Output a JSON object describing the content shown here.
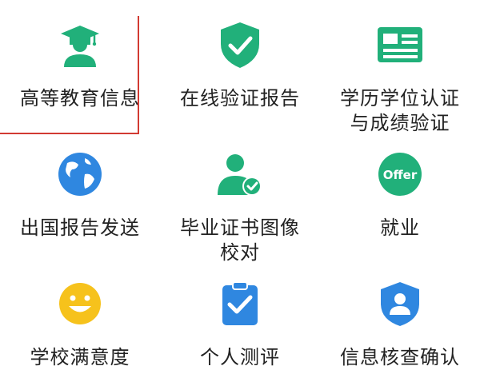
{
  "grid": {
    "items": [
      {
        "label": "高等教育信息",
        "icon": "graduate-icon"
      },
      {
        "label": "在线验证报告",
        "icon": "shield-check-icon"
      },
      {
        "label": "学历学位认证\n与成绩验证",
        "icon": "certificate-icon"
      },
      {
        "label": "出国报告发送",
        "icon": "globe-icon"
      },
      {
        "label": "毕业证书图像\n校对",
        "icon": "person-check-icon"
      },
      {
        "label": "就业",
        "icon": "offer-icon",
        "icon_text": "Offer"
      },
      {
        "label": "学校满意度",
        "icon": "smiley-icon"
      },
      {
        "label": "个人测评",
        "icon": "clipboard-check-icon"
      },
      {
        "label": "信息核查确认",
        "icon": "badge-person-icon"
      }
    ]
  },
  "colors": {
    "green": "#21b07a",
    "blue": "#2f87e0",
    "yellow": "#f6c21c",
    "highlight_border": "#d23a32",
    "text": "#222222"
  }
}
